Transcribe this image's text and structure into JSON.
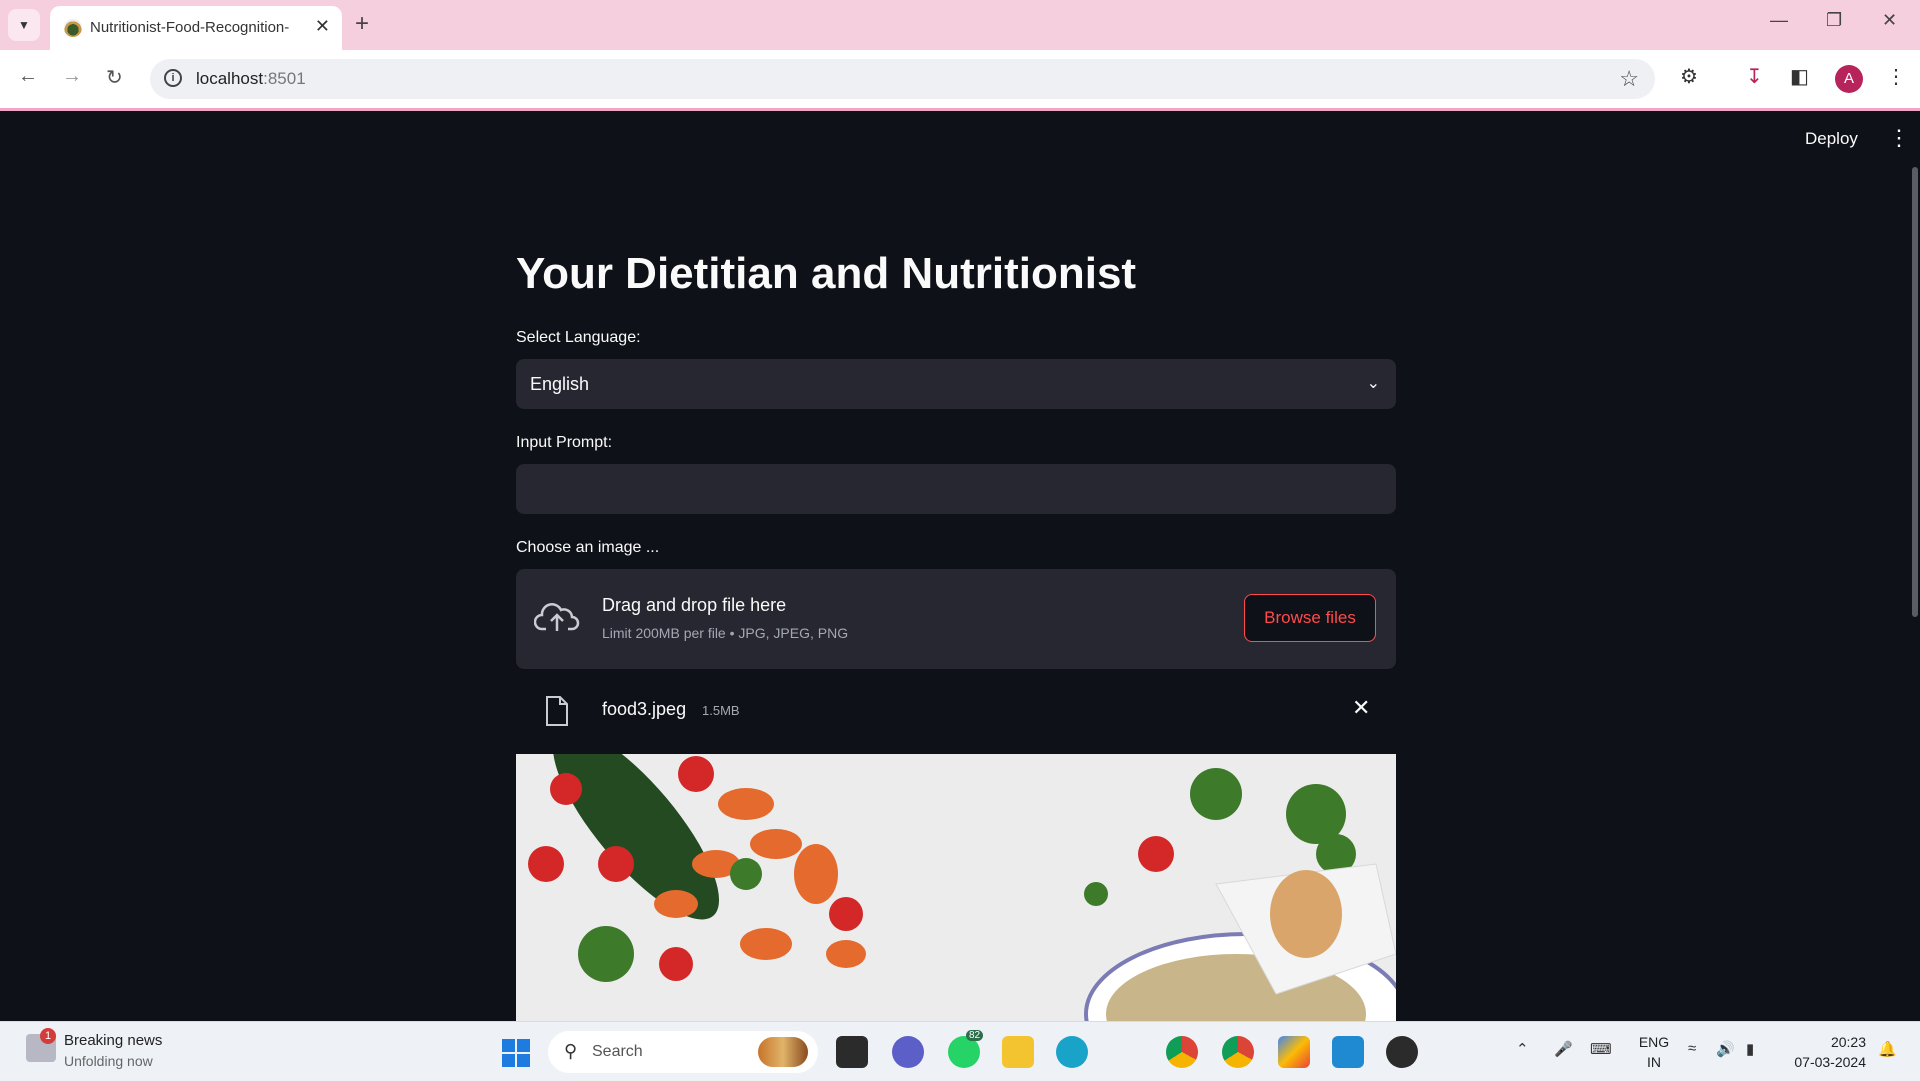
{
  "browser": {
    "tab_title": "Nutritionist-Food-Recognition-",
    "url_host": "localhost",
    "url_port": ":8501",
    "avatar_letter": "A"
  },
  "app": {
    "deploy_label": "Deploy",
    "title": "Your Dietitian and Nutritionist",
    "language_label": "Select Language:",
    "language_value": "English",
    "prompt_label": "Input Prompt:",
    "prompt_value": "",
    "image_label": "Choose an image ...",
    "dropzone_title": "Drag and drop file here",
    "dropzone_sub": "Limit 200MB per file • JPG, JPEG, PNG",
    "browse_label": "Browse files",
    "file_name": "food3.jpeg",
    "file_size": "1.5MB"
  },
  "taskbar": {
    "news_badge": "1",
    "news_title": "Breaking news",
    "news_sub": "Unfolding now",
    "search_label": "Search",
    "whatsapp_badge": "82",
    "lang_line1": "ENG",
    "lang_line2": "IN",
    "time": "20:23",
    "date": "07-03-2024"
  },
  "colors": {
    "app_bg": "#0e1117",
    "widget_bg": "#262730",
    "accent": "#ff4b4b",
    "tab_bar": "#f6cfdf"
  }
}
